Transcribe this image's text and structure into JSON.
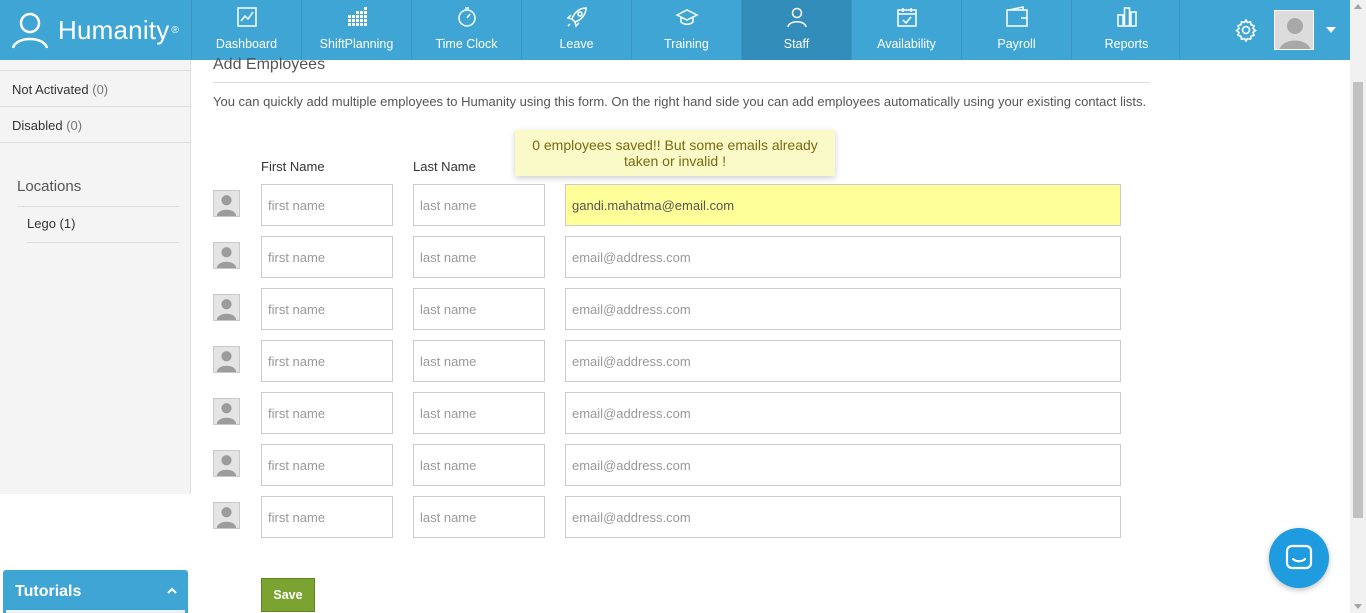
{
  "brand": {
    "name": "Humanity",
    "reg": "®"
  },
  "nav": [
    {
      "label": "Dashboard",
      "icon": "dashboard-icon"
    },
    {
      "label": "ShiftPlanning",
      "icon": "calendar-grid-icon"
    },
    {
      "label": "Time Clock",
      "icon": "stopwatch-icon"
    },
    {
      "label": "Leave",
      "icon": "rocket-icon"
    },
    {
      "label": "Training",
      "icon": "graduation-cap-icon"
    },
    {
      "label": "Staff",
      "icon": "user-icon",
      "active": true
    },
    {
      "label": "Availability",
      "icon": "calendar-check-icon"
    },
    {
      "label": "Payroll",
      "icon": "wallet-icon"
    },
    {
      "label": "Reports",
      "icon": "bar-chart-icon"
    }
  ],
  "sidebar": {
    "status_items": [
      {
        "label": "Not Activated",
        "count": "(0)"
      },
      {
        "label": "Disabled",
        "count": "(0)"
      }
    ],
    "locations_title": "Locations",
    "locations": [
      {
        "label": "Lego (1)"
      }
    ]
  },
  "main": {
    "section_title": "Add Employees",
    "description": "You can quickly add multiple employees to Humanity using this form. On the right hand side you can add employees automatically using your existing contact lists.",
    "col_first": "First Name",
    "col_last": "Last Name",
    "notice": "0 employees saved!! But some emails already taken or invalid !",
    "placeholders": {
      "first": "first name",
      "last": "last name",
      "email": "email@address.com"
    },
    "rows": [
      {
        "first": "",
        "last": "",
        "email": "gandi.mahatma@email.com",
        "highlight": true
      },
      {
        "first": "",
        "last": "",
        "email": ""
      },
      {
        "first": "",
        "last": "",
        "email": ""
      },
      {
        "first": "",
        "last": "",
        "email": ""
      },
      {
        "first": "",
        "last": "",
        "email": ""
      },
      {
        "first": "",
        "last": "",
        "email": ""
      },
      {
        "first": "",
        "last": "",
        "email": ""
      }
    ],
    "save_label": "Save"
  },
  "tutorials": {
    "label": "Tutorials"
  },
  "colors": {
    "brand_blue": "#3fa5d4",
    "save_green": "#7aa331",
    "highlight_yellow": "#ffff99",
    "chat_blue": "#1f9be0"
  }
}
